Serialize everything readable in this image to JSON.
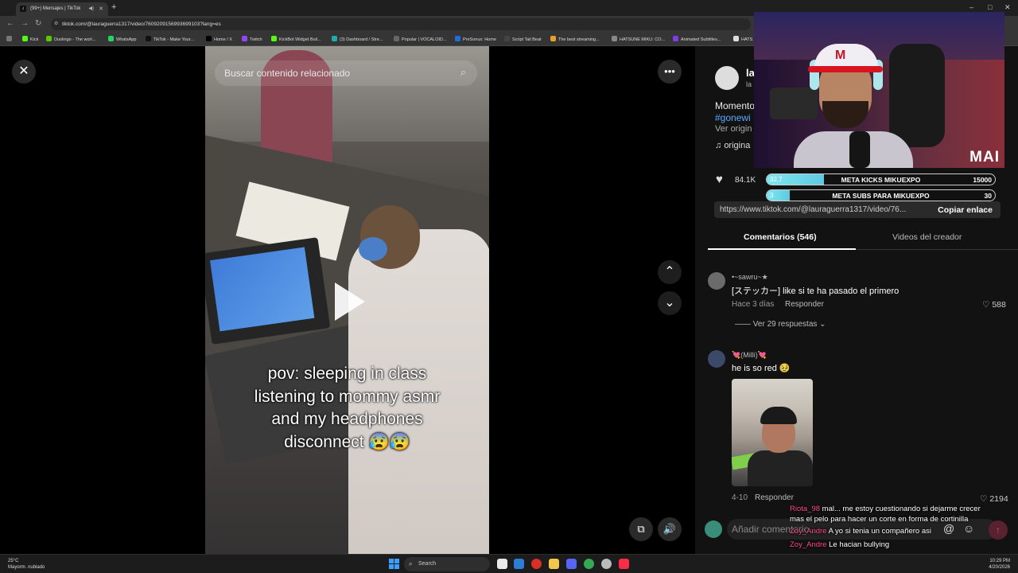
{
  "browser": {
    "tab_title": "(99+) Mensajes | TikTok",
    "url": "tiktok.com/@lauraguerra1317/video/7609209156993699103?lang=es",
    "bookmarks": [
      "Kick",
      "Duolingo - The worl...",
      "WhatsApp",
      "TikTok - Make Your...",
      "Home / X",
      "Twitch",
      "KickBot Widget Buil...",
      "(3) Dashboard / Stre...",
      "Popular | VOCALOID...",
      "PreSonus: Home",
      "Script Tail Beat",
      "The best streaming...",
      "HATSUNE MIKU: CO...",
      "Animated Subtitles...",
      "HATS"
    ]
  },
  "video": {
    "search_placeholder": "Buscar contenido relacionado",
    "caption_lines": [
      "pov: sleeping in class",
      "listening to mommy asmr",
      "and my headphones",
      "disconnect 😰😰"
    ]
  },
  "post": {
    "username": "la",
    "handle": "la",
    "description": "Momento",
    "hashtag": "#gonewi",
    "see_original": "Ver origin",
    "music": "origina",
    "likes": "84.1K",
    "link": "https://www.tiktok.com/@lauraguerra1317/video/76...",
    "copy_link": "Copiar enlace"
  },
  "tabs": {
    "comments": "Comentarios (546)",
    "creator_videos": "Videos del creador"
  },
  "comments": [
    {
      "name": "•~sawru~★",
      "text": "[ステッカー] like si te ha pasado el primero",
      "time": "Hace 3 días",
      "reply": "Responder",
      "likes": "588",
      "replies": "Ver 29 respuestas"
    },
    {
      "name": "💘(Milli)💘",
      "text": "he is so red 🥹",
      "time": "4-10",
      "reply": "Responder",
      "likes": "2194"
    }
  ],
  "add_comment": {
    "placeholder": "Añadir comentario..."
  },
  "stream_overlay": {
    "logo": "MAI",
    "goal_kicks": {
      "label": "META KICKS MIKUEXPO",
      "current": "32.7",
      "target": "15000",
      "progress": 0.25
    },
    "goal_subs": {
      "label": "META SUBS PARA MIKUEXPO",
      "current": "3",
      "target": "30",
      "progress": 0.1
    },
    "chat": [
      {
        "user": "Riota_98",
        "text": "mal... me estoy cuestionando si dejarme crecer mas el pelo para hacer un corte en forma de cortinilla"
      },
      {
        "user": "Zoy_Andre",
        "text": "A yo si tenia un compañero asi"
      },
      {
        "user": "Zoy_Andre",
        "text": "Le hacian bullying"
      }
    ]
  },
  "taskbar": {
    "temp": "25°C",
    "weather": "Mayorm. nublado",
    "search": "Search",
    "time": "10:29 PM",
    "date": "4/20/2026"
  },
  "colors": {
    "accent_link": "#5aa9ff",
    "chat_name": "#ff4b8b",
    "goal_fill": "#7fe7f0",
    "send_button": "#5a2230"
  }
}
